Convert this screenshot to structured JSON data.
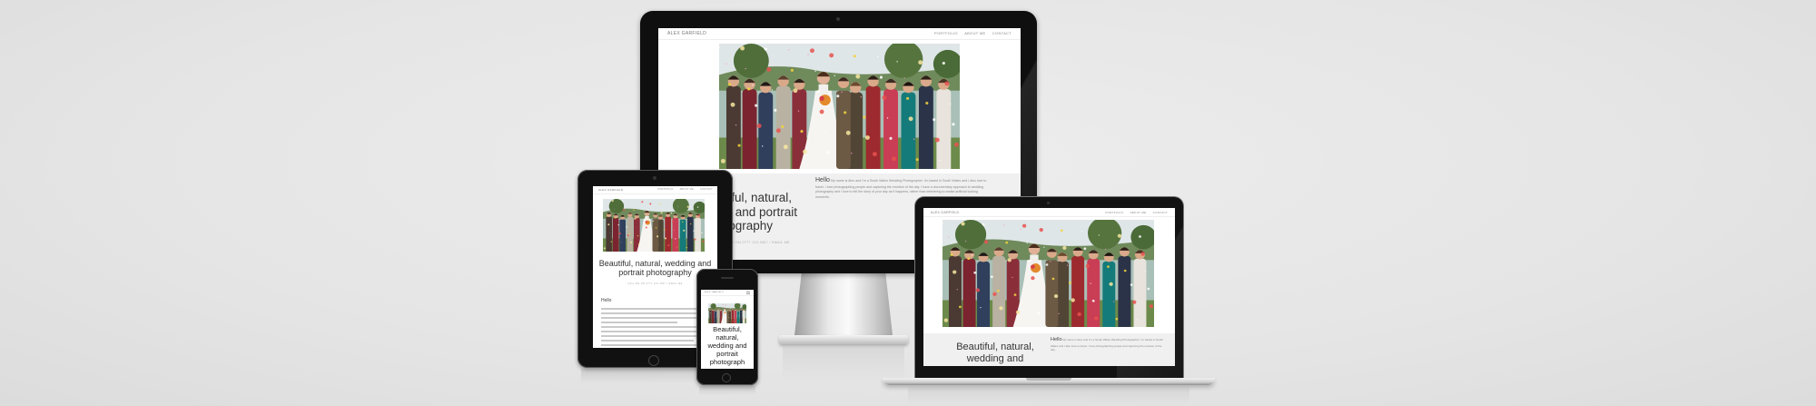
{
  "site": {
    "logo": "ALEX GARFIELD",
    "nav": [
      "PORTFOLIO",
      "ABOUT ME",
      "CONTACT"
    ],
    "headline": "Beautiful, natural, wedding and portrait photography",
    "headline_short": "Beautiful, natural, wedding and",
    "imac_headline_lines": [
      "utiful, natural,",
      "ng and portrait",
      "otography"
    ],
    "phone_headline_lines": [
      "Beautiful,",
      "natural,",
      "wedding and",
      "portrait",
      "photograph"
    ],
    "subline": "CALL ME ON 0777 123 4567 / EMAIL ME",
    "hello": "Hello",
    "intro": "My name is Alex and I'm a South Wales Wedding Photographer. I'm based in South Wales and I also love to travel. I love photographing people and capturing the emotion of the day.",
    "intro2": "I have a documentary approach to wedding photography and I love to tell the story of your day as it happens, rather than interfering to create artificial looking moments."
  },
  "colors": {
    "background": "#e7e7e7",
    "device_black": "#111111",
    "silver": "#c8c8c8",
    "panel": "#f0f0f0"
  },
  "devices": [
    "imac",
    "ipad",
    "iphone",
    "macbook"
  ]
}
